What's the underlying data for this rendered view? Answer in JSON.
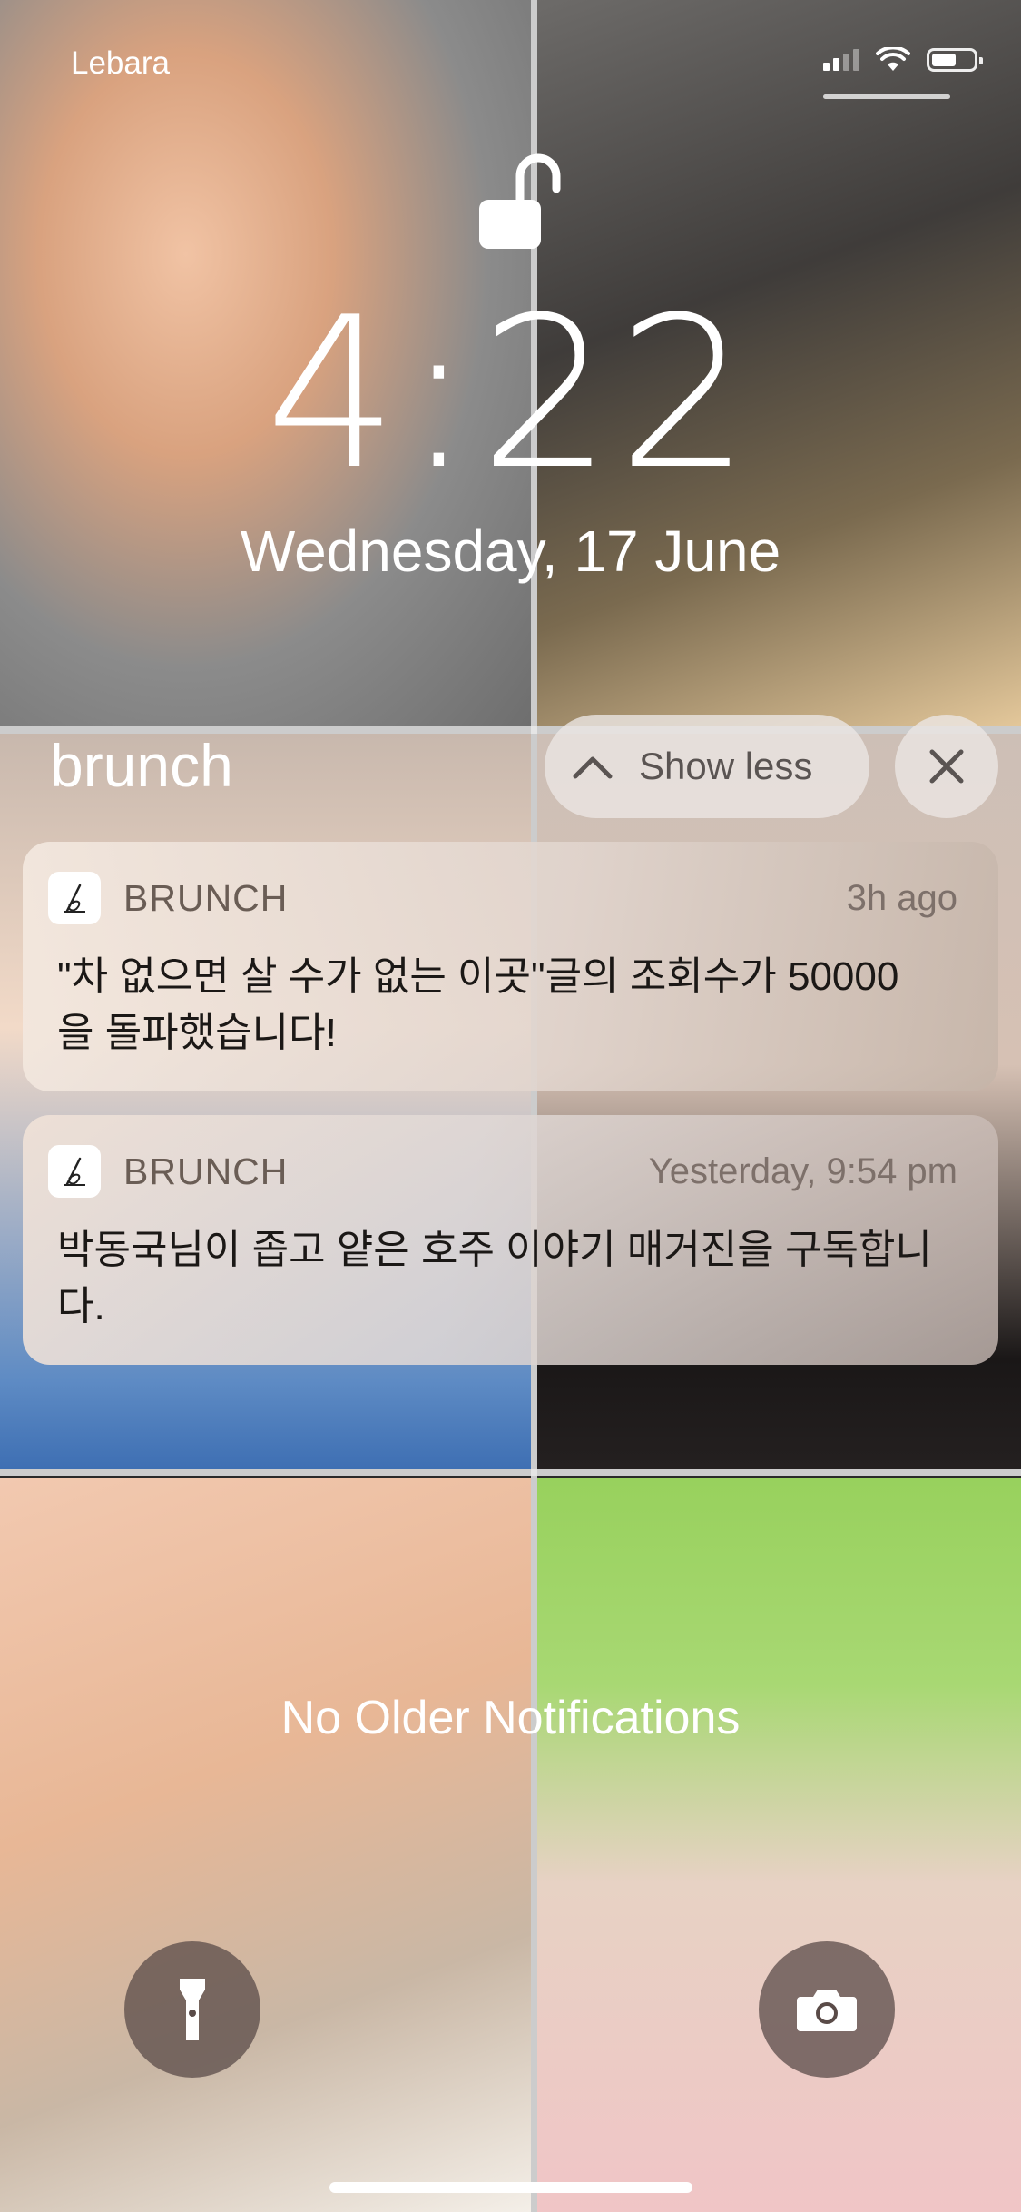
{
  "status_bar": {
    "carrier": "Lebara"
  },
  "lock_screen": {
    "time": "4:22",
    "date": "Wednesday, 17 June"
  },
  "notification_group": {
    "title": "brunch",
    "show_less_label": "Show less"
  },
  "notifications": [
    {
      "app": "BRUNCH",
      "time": "3h ago",
      "body": "\"차 없으면 살 수가 없는 이곳\"글의 조회수가 50000을 돌파했습니다!"
    },
    {
      "app": "BRUNCH",
      "time": "Yesterday, 9:54 pm",
      "body": "박동국님이 좁고 얕은 호주 이야기 매거진을 구독합니다."
    }
  ],
  "footer": {
    "no_older_label": "No Older Notifications"
  },
  "colors": {
    "text_primary": "#ffffff",
    "notification_bg": "#e9ddd4",
    "control_bg": "#5a4b48"
  }
}
